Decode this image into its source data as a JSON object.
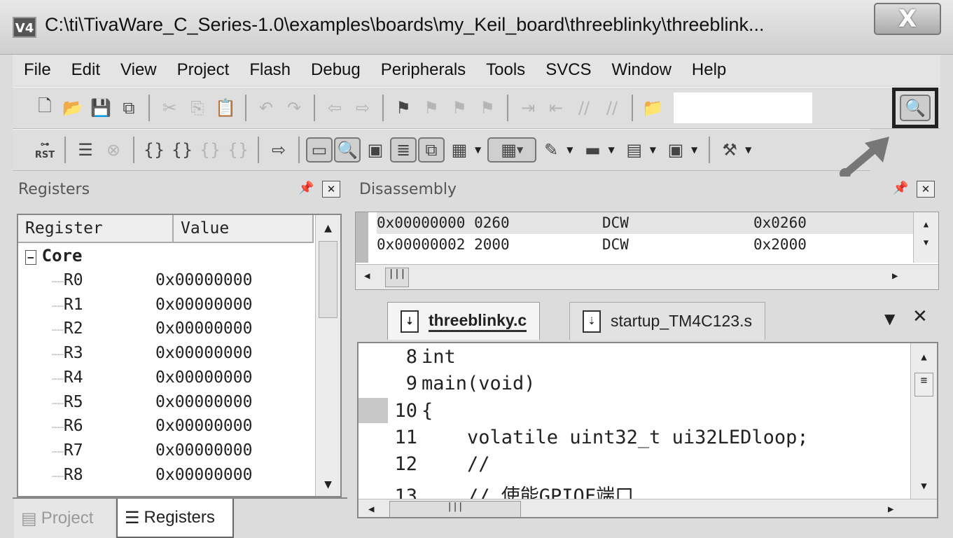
{
  "window": {
    "title": "C:\\ti\\TivaWare_C_Series-1.0\\examples\\boards\\my_Keil_board\\threeblinky\\threeblink...",
    "close_label": "X",
    "app_icon": "V4"
  },
  "menu": [
    "File",
    "Edit",
    "View",
    "Project",
    "Flash",
    "Debug",
    "Peripherals",
    "Tools",
    "SVCS",
    "Window",
    "Help"
  ],
  "registers_panel": {
    "title": "Registers",
    "columns": [
      "Register",
      "Value"
    ],
    "group": "Core",
    "rows": [
      {
        "name": "R0",
        "value": "0x00000000"
      },
      {
        "name": "R1",
        "value": "0x00000000"
      },
      {
        "name": "R2",
        "value": "0x00000000"
      },
      {
        "name": "R3",
        "value": "0x00000000"
      },
      {
        "name": "R4",
        "value": "0x00000000"
      },
      {
        "name": "R5",
        "value": "0x00000000"
      },
      {
        "name": "R6",
        "value": "0x00000000"
      },
      {
        "name": "R7",
        "value": "0x00000000"
      },
      {
        "name": "R8",
        "value": "0x00000000"
      }
    ],
    "bottom_tabs": [
      "Project",
      "Registers"
    ],
    "active_bottom_tab": "Registers"
  },
  "disassembly_panel": {
    "title": "Disassembly",
    "rows": [
      {
        "address": "0x00000000",
        "opcode": "0260",
        "mnemonic": "DCW",
        "operand": "0x0260"
      },
      {
        "address": "0x00000002",
        "opcode": "2000",
        "mnemonic": "DCW",
        "operand": "0x2000"
      }
    ]
  },
  "editor": {
    "tabs": [
      "threeblinky.c",
      "startup_TM4C123.s"
    ],
    "active_tab": "threeblinky.c",
    "lines": [
      {
        "n": "8",
        "text": "int"
      },
      {
        "n": "9",
        "text": "main(void)"
      },
      {
        "n": "10",
        "text": "{"
      },
      {
        "n": "11",
        "text": "    volatile uint32_t ui32LEDloop;"
      },
      {
        "n": "12",
        "text": "    //"
      },
      {
        "n": "13",
        "text": "    // 使能GPIOF端口"
      }
    ],
    "current_line": "10"
  },
  "toolbar": {
    "reset_label": "RST"
  },
  "colors": {
    "highlight": "#222222",
    "current_line_marker": "#c8c8c8"
  }
}
